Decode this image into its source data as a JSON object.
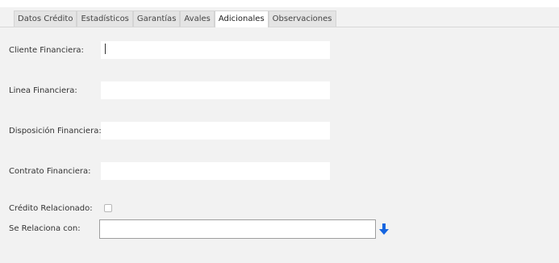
{
  "tabs": [
    {
      "label": "Datos Crédito"
    },
    {
      "label": "Estadísticos"
    },
    {
      "label": "Garantías"
    },
    {
      "label": "Avales"
    },
    {
      "label": "Adicionales",
      "active": true
    },
    {
      "label": "Observaciones"
    }
  ],
  "form": {
    "cliente_financiera": {
      "label": "Cliente Financiera:",
      "value": ""
    },
    "linea_financiera": {
      "label": "Linea Financiera:",
      "value": ""
    },
    "disposicion_financiera": {
      "label": "Disposición Financiera:",
      "value": ""
    },
    "contrato_financiera": {
      "label": "Contrato Financiera:",
      "value": ""
    },
    "credito_relacionado": {
      "label": "Crédito Relacionado:",
      "checked": false
    },
    "se_relaciona_con": {
      "label": "Se Relaciona con:",
      "value": ""
    }
  },
  "colors": {
    "accent": "#1565e0",
    "field_bg": "#ffffff",
    "panel_bg": "#f2f2f2"
  },
  "icons": {
    "relate_button": "arrow-down-icon"
  }
}
